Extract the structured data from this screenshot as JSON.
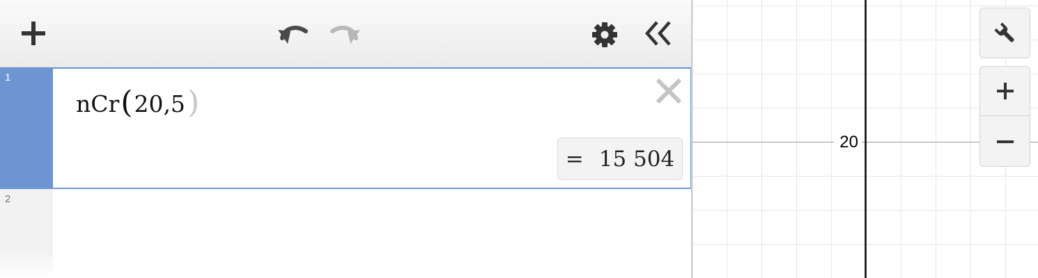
{
  "toolbar": {
    "add_icon": "plus-icon",
    "undo_icon": "undo-icon",
    "redo_icon": "redo-icon",
    "settings_icon": "gear-icon",
    "collapse_icon": "double-chevron-left-icon"
  },
  "expressions": [
    {
      "index": "1",
      "func": "nCr",
      "args": "20,5",
      "result_eq": "=",
      "result_value": "15 504",
      "selected": true
    },
    {
      "index": "2",
      "func": "",
      "args": "",
      "selected": false
    }
  ],
  "graph": {
    "y_tick_label": "20",
    "controls": {
      "settings_icon": "wrench-icon",
      "zoom_in_icon": "plus-icon",
      "zoom_out_icon": "minus-icon"
    }
  },
  "colors": {
    "selected_gutter": "#6c95d2",
    "selected_border": "#6c9ad6",
    "grid_line": "#e6e6e6",
    "axis": "#000000"
  }
}
